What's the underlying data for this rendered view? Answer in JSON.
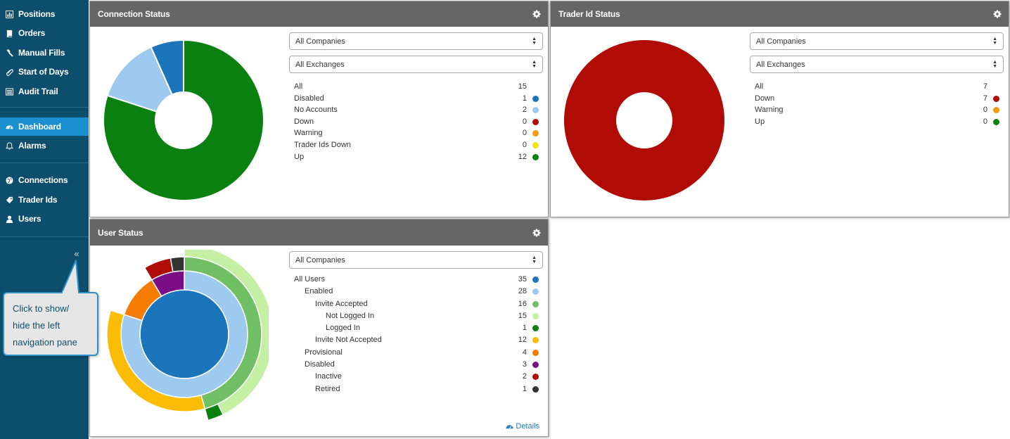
{
  "sidebar": {
    "items": [
      {
        "label": "Positions",
        "icon": "bar-chart-icon"
      },
      {
        "label": "Orders",
        "icon": "book-icon"
      },
      {
        "label": "Manual Fills",
        "icon": "gavel-icon"
      },
      {
        "label": "Start of Days",
        "icon": "paperclip-icon"
      },
      {
        "label": "Audit Trail",
        "icon": "list-icon"
      },
      {
        "label": "Dashboard",
        "icon": "dashboard-icon"
      },
      {
        "label": "Alarms",
        "icon": "bell-icon"
      },
      {
        "label": "Connections",
        "icon": "globe-icon"
      },
      {
        "label": "Trader Ids",
        "icon": "tag-icon"
      },
      {
        "label": "Users",
        "icon": "user-icon"
      }
    ],
    "collapse": "«"
  },
  "callout": {
    "text": "Click to show/ hide the left navigation pane"
  },
  "connection_panel": {
    "title": "Connection Status",
    "company_select": "All Companies",
    "exchange_select": "All Exchanges",
    "legend": [
      {
        "label": "All",
        "count": "15",
        "color": ""
      },
      {
        "label": "Disabled",
        "count": "1",
        "color": "#1a75bb"
      },
      {
        "label": "No Accounts",
        "count": "2",
        "color": "#9ecaf0"
      },
      {
        "label": "Down",
        "count": "0",
        "color": "#b10b06"
      },
      {
        "label": "Warning",
        "count": "0",
        "color": "#f39c12"
      },
      {
        "label": "Trader Ids Down",
        "count": "0",
        "color": "#f5e10f"
      },
      {
        "label": "Up",
        "count": "12",
        "color": "#0a8010"
      }
    ]
  },
  "traderid_panel": {
    "title": "Trader Id Status",
    "company_select": "All Companies",
    "exchange_select": "All Exchanges",
    "legend": [
      {
        "label": "All",
        "count": "7",
        "color": ""
      },
      {
        "label": "Down",
        "count": "7",
        "color": "#b10b06"
      },
      {
        "label": "Warning",
        "count": "0",
        "color": "#f39c12"
      },
      {
        "label": "Up",
        "count": "0",
        "color": "#0a8010"
      }
    ]
  },
  "user_panel": {
    "title": "User Status",
    "company_select": "All Companies",
    "details": "Details",
    "legend": [
      {
        "label": "All Users",
        "count": "35",
        "color": "#1a75bb",
        "level": 0
      },
      {
        "label": "Enabled",
        "count": "28",
        "color": "#9ecaf0",
        "level": 1
      },
      {
        "label": "Invite Accepted",
        "count": "16",
        "color": "#70bf64",
        "level": 2
      },
      {
        "label": "Not Logged In",
        "count": "15",
        "color": "#c5f0a4",
        "level": 3
      },
      {
        "label": "Logged In",
        "count": "1",
        "color": "#0a8010",
        "level": 3
      },
      {
        "label": "Invite Not Accepted",
        "count": "12",
        "color": "#fbbc05",
        "level": 2
      },
      {
        "label": "Provisional",
        "count": "4",
        "color": "#f57c00",
        "level": 1
      },
      {
        "label": "Disabled",
        "count": "3",
        "color": "#7b0d84",
        "level": 1
      },
      {
        "label": "Inactive",
        "count": "2",
        "color": "#b10b06",
        "level": 2
      },
      {
        "label": "Retired",
        "count": "1",
        "color": "#333333",
        "level": 2
      }
    ]
  },
  "chart_data": [
    {
      "type": "pie",
      "categories": [
        "Disabled",
        "No Accounts",
        "Up"
      ],
      "values": [
        1,
        2,
        12
      ],
      "colors": [
        "#1a75bb",
        "#9ecaf0",
        "#0a8010"
      ]
    },
    {
      "type": "pie",
      "categories": [
        "Down"
      ],
      "values": [
        7
      ],
      "colors": [
        "#b10b06"
      ]
    },
    {
      "type": "pie",
      "rings": [
        {
          "categories": [
            "All Users"
          ],
          "values": [
            35
          ],
          "colors": [
            "#1a75bb"
          ]
        },
        {
          "categories": [
            "Enabled",
            "Provisional",
            "Disabled"
          ],
          "values": [
            28,
            4,
            3
          ],
          "colors": [
            "#9ecaf0",
            "#f57c00",
            "#7b0d84"
          ]
        },
        {
          "categories": [
            "Invite Accepted",
            "Invite Not Accepted",
            "Inactive",
            "Retired"
          ],
          "values": [
            16,
            12,
            2,
            1
          ],
          "colors": [
            "#70bf64",
            "#fbbc05",
            "#b10b06",
            "#333333"
          ]
        },
        {
          "categories": [
            "Not Logged In",
            "Logged In"
          ],
          "values": [
            15,
            1
          ],
          "colors": [
            "#c5f0a4",
            "#0a8010"
          ]
        }
      ]
    }
  ]
}
